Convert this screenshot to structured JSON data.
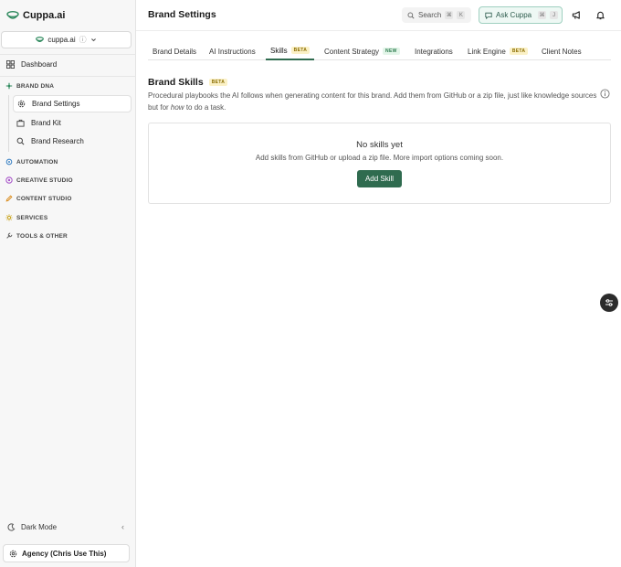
{
  "app": {
    "name": "Cuppa.ai"
  },
  "workspace": {
    "name": "cuppa.ai"
  },
  "sidebar": {
    "dashboard_label": "Dashboard",
    "sections": {
      "brand_dna": "BRAND DNA",
      "automation": "AUTOMATION",
      "creative_studio": "CREATIVE STUDIO",
      "content_studio": "CONTENT STUDIO",
      "services": "SERVICES",
      "tools_other": "TOOLS & OTHER"
    },
    "brand_dna_items": [
      {
        "label": "Brand Settings",
        "icon": "gear-icon",
        "active": true
      },
      {
        "label": "Brand Kit",
        "icon": "kit-icon",
        "active": false
      },
      {
        "label": "Brand Research",
        "icon": "search-icon",
        "active": false
      }
    ],
    "dark_mode_label": "Dark Mode",
    "agency_label": "Agency (Chris Use This)"
  },
  "header": {
    "title": "Brand Settings",
    "search_label": "Search",
    "search_kbd": [
      "⌘",
      "K"
    ],
    "ask_label": "Ask Cuppa",
    "ask_kbd": [
      "⌘",
      "J"
    ]
  },
  "tabs": [
    {
      "label": "Brand Details"
    },
    {
      "label": "AI Instructions"
    },
    {
      "label": "Skills",
      "badge": "BETA",
      "active": true
    },
    {
      "label": "Content Strategy",
      "badge": "NEW"
    },
    {
      "label": "Integrations"
    },
    {
      "label": "Link Engine",
      "badge": "BETA"
    },
    {
      "label": "Client Notes"
    }
  ],
  "content": {
    "title": "Brand Skills",
    "title_badge": "BETA",
    "description_main": "Procedural playbooks the AI follows when generating content for this brand. Add them from GitHub or a zip file, just like knowledge sources but for ",
    "description_em": "how",
    "description_end": " to do a task.",
    "empty_title": "No skills yet",
    "empty_subtitle": "Add skills from GitHub or upload a zip file. More import options coming soon.",
    "add_button": "Add Skill"
  },
  "colors": {
    "accent": "#2f6b4f",
    "beta_badge_bg": "#fbf1c7",
    "new_badge_bg": "#e3f5e9",
    "ask_border": "#9fd0c0"
  }
}
